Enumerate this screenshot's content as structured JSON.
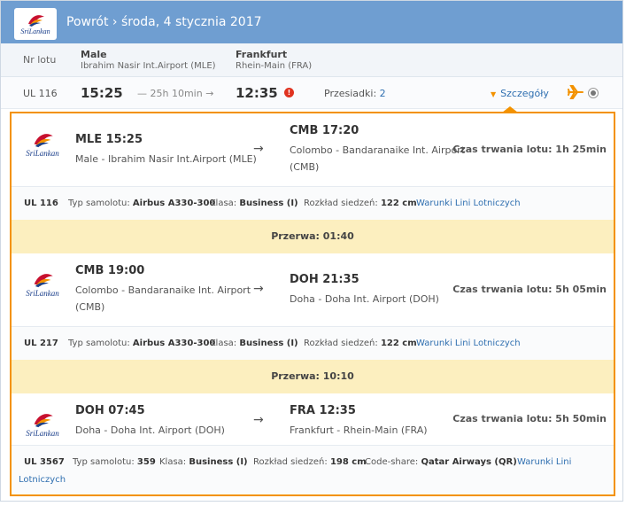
{
  "header": {
    "logo_text": "SriLankan",
    "title": "Powrót › środa, 4 stycznia 2017"
  },
  "route": {
    "nr_lotu_label": "Nr lotu",
    "from_city": "Male",
    "from_airport": "Ibrahim Nasir Int.Airport (MLE)",
    "to_city": "Frankfurt",
    "to_airport": "Rhein-Main (FRA)"
  },
  "summary": {
    "flight_number": "UL 116",
    "departure": "15:25",
    "duration": "— 25h 10min →",
    "arrival": "12:35",
    "warning_glyph": "!",
    "stops_label": "Przesiadki:",
    "stops_count": "2",
    "details_label": "Szczegóły"
  },
  "segments": [
    {
      "logo_text": "SriLankan",
      "dep_time": "MLE 15:25",
      "dep_place": "Male - Ibrahim Nasir Int.Airport (MLE)",
      "arrow": "→",
      "arr_time": "CMB 17:20",
      "arr_place_1": "Colombo - Bandaranaike Int. Airport",
      "arr_place_2": "(CMB)",
      "duration": "Czas trwania lotu: 1h 25min",
      "info": {
        "flight": "UL 116",
        "aircraft_label": "Typ samolotu:",
        "aircraft": "Airbus A330-300",
        "class_label": "Klasa:",
        "class": "Business (I)",
        "seat_label": "Rozkład siedzeń:",
        "seat": "122 cm",
        "terms": "Warunki Lini Lotniczych"
      }
    },
    {
      "logo_text": "SriLankan",
      "dep_time": "CMB 19:00",
      "dep_place_1": "Colombo - Bandaranaike Int. Airport",
      "dep_place_2": "(CMB)",
      "arrow": "→",
      "arr_time": "DOH 21:35",
      "arr_place": "Doha - Doha Int. Airport (DOH)",
      "duration": "Czas trwania lotu: 5h 05min",
      "info": {
        "flight": "UL 217",
        "aircraft_label": "Typ samolotu:",
        "aircraft": "Airbus A330-300",
        "class_label": "Klasa:",
        "class": "Business (I)",
        "seat_label": "Rozkład siedzeń:",
        "seat": "122 cm",
        "terms": "Warunki Lini Lotniczych"
      }
    },
    {
      "logo_text": "SriLankan",
      "dep_time": "DOH 07:45",
      "dep_place": "Doha - Doha Int. Airport (DOH)",
      "arrow": "→",
      "arr_time": "FRA 12:35",
      "arr_place": "Frankfurt - Rhein-Main (FRA)",
      "duration": "Czas trwania lotu: 5h 50min",
      "info": {
        "flight": "UL 3567",
        "aircraft_label": "Typ samolotu:",
        "aircraft": "359",
        "class_label": "Klasa:",
        "class": "Business (I)",
        "seat_label": "Rozkład siedzeń:",
        "seat": "198 cm",
        "codeshare_label": "Code-share:",
        "codeshare": "Qatar Airways (QR)",
        "terms_1": "Warunki Lini",
        "terms_2": "Lotniczych"
      }
    }
  ],
  "breaks": [
    {
      "label": "Przerwa: 01:40"
    },
    {
      "label": "Przerwa: 10:10"
    }
  ],
  "colors": {
    "header": "#6f9ed1",
    "accent": "#f39200",
    "link": "#2f6fb0",
    "break_bg": "#fcefbf",
    "warning": "#e0321f"
  },
  "icons": {
    "airline_logo": "srilankan-peacock-logo",
    "warning": "warning-icon",
    "plane": "plane-icon",
    "radio": "radio-button-icon",
    "details_toggle": "triangle-down-icon"
  }
}
